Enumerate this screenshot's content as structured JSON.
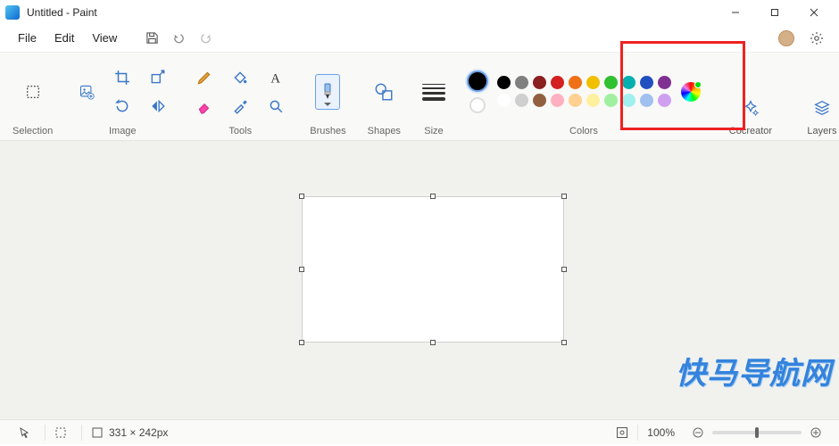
{
  "title": "Untitled - Paint",
  "menubar": {
    "file": "File",
    "edit": "Edit",
    "view": "View"
  },
  "ribbon": {
    "selection": "Selection",
    "image": "Image",
    "tools": "Tools",
    "brushes": "Brushes",
    "shapes": "Shapes",
    "size": "Size",
    "colors": "Colors",
    "cocreator": "Cocreator",
    "layers": "Layers"
  },
  "palette_row1": [
    "#000000",
    "#7f7f7f",
    "#8a2020",
    "#d42020",
    "#f07018",
    "#f0c000",
    "#30c030",
    "#00b0b0",
    "#2050c0",
    "#803090"
  ],
  "palette_row2": [
    "#ffffff",
    "#cfcfcf",
    "#916040",
    "#ffb0c0",
    "#ffd090",
    "#fff0a0",
    "#a0f0a0",
    "#a0f0f0",
    "#a0c0f0",
    "#d0a0f0"
  ],
  "status": {
    "canvas_size": "331 × 242px",
    "zoom": "100%"
  },
  "watermark": "快马导航网"
}
